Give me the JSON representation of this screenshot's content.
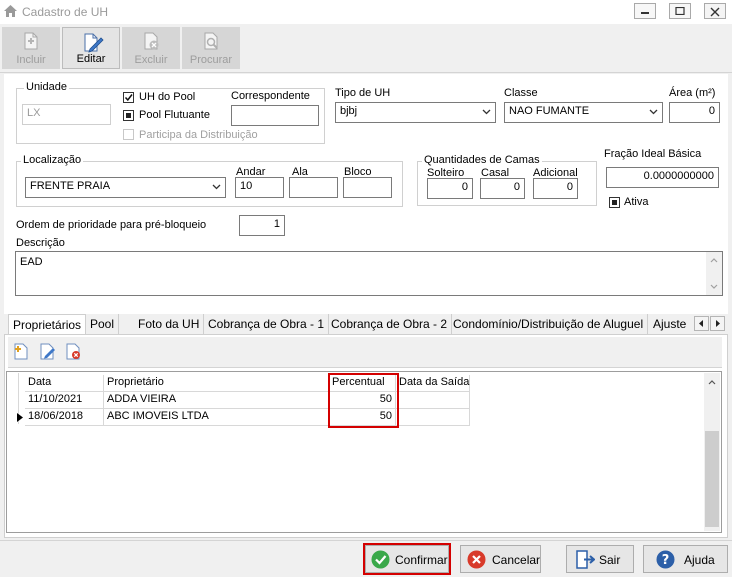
{
  "window": {
    "title": "Cadastro de UH"
  },
  "toolbar": {
    "incluir": "Incluir",
    "editar": "Editar",
    "excluir": "Excluir",
    "procurar": "Procurar"
  },
  "form": {
    "unidade": {
      "label": "Unidade",
      "value": "LX"
    },
    "uh_do_pool": {
      "label": "UH do Pool",
      "checked": true
    },
    "pool_flutuante": {
      "label": "Pool Flutuante",
      "checked": true
    },
    "participa_distribuicao": {
      "label": "Participa da Distribuição",
      "checked": false
    },
    "correspondente": {
      "label": "Correspondente",
      "value": ""
    },
    "tipo_uh": {
      "label": "Tipo de UH",
      "value": "bjbj"
    },
    "classe": {
      "label": "Classe",
      "value": "NAO FUMANTE"
    },
    "area": {
      "label": "Área (m²)",
      "value": "0"
    },
    "localizacao": {
      "label": "Localização",
      "value": "FRENTE PRAIA"
    },
    "andar": {
      "label": "Andar",
      "value": "10"
    },
    "ala": {
      "label": "Ala",
      "value": ""
    },
    "bloco": {
      "label": "Bloco",
      "value": ""
    },
    "camas": {
      "title": "Quantidades de Camas",
      "solteiro": {
        "label": "Solteiro",
        "value": "0"
      },
      "casal": {
        "label": "Casal",
        "value": "0"
      },
      "adicional": {
        "label": "Adicional",
        "value": "0"
      }
    },
    "fracao": {
      "label": "Fração Ideal Básica",
      "value": "0.0000000000"
    },
    "ativa": {
      "label": "Ativa",
      "checked": true
    },
    "ordem": {
      "label": "Ordem de prioridade para pré-bloqueio",
      "value": "1"
    },
    "descricao": {
      "label": "Descrição",
      "value": "EAD"
    }
  },
  "tabs": [
    "Proprietários",
    "Pool",
    "Foto da UH",
    "Cobrança de Obra - 1",
    "Cobrança de Obra - 2",
    "Condomínio/Distribuição de Aluguel",
    "Ajuste"
  ],
  "grid": {
    "columns": {
      "data": "Data",
      "proprietario": "Proprietário",
      "percentual": "Percentual",
      "saida": "Data da Saída"
    },
    "rows": [
      {
        "data": "11/10/2021",
        "proprietario": "ADDA VIEIRA",
        "percentual": "50",
        "saida": ""
      },
      {
        "data": "18/06/2018",
        "proprietario": "ABC IMOVEIS LTDA",
        "percentual": "50",
        "saida": ""
      }
    ]
  },
  "buttons": {
    "confirmar": "Confirmar",
    "cancelar": "Cancelar",
    "sair": "Sair",
    "ajuda": "Ajuda"
  },
  "colors": {
    "highlight": "#d40000",
    "confirm_green": "#3aa84a",
    "cancel_red": "#d83a2a",
    "help_blue": "#2c5fa8"
  }
}
